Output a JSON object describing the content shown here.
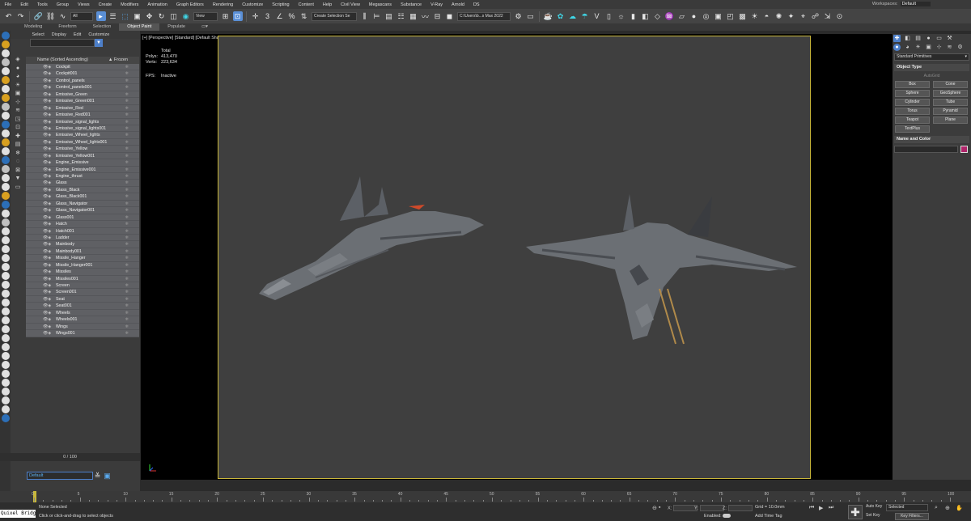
{
  "menu": [
    "File",
    "Edit",
    "Tools",
    "Group",
    "Views",
    "Create",
    "Modifiers",
    "Animation",
    "Graph Editors",
    "Rendering",
    "Customize",
    "Scripting",
    "Content",
    "Help",
    "Civil View",
    "Megascans",
    "Substance",
    "V-Ray",
    "Arnold",
    "DS"
  ],
  "workspaces": {
    "label": "Workspaces:",
    "value": "Default"
  },
  "toolbar": {
    "filter_value": "All",
    "view_value": "View",
    "selection_set_placeholder": "Create Selection Se",
    "path_value": "C:\\Users\\b...s Max 2022"
  },
  "ribbon_tabs": [
    "Modeling",
    "Freeform",
    "Selection",
    "Object Paint",
    "Populate"
  ],
  "ribbon_active": "Object Paint",
  "scene_explorer": {
    "tabs": [
      "Select",
      "Display",
      "Edit",
      "Customize"
    ],
    "header": "Name (Sorted Ascending)",
    "frozen_label": "▲ Frozen",
    "items": [
      "Cockpit",
      "Cockpit001",
      "Control_panels",
      "Control_panels001",
      "Emissive_Green",
      "Emissive_Green001",
      "Emissive_Red",
      "Emissive_Red001",
      "Emissive_signal_lights",
      "Emissive_signal_lights001",
      "Emissive_Wheel_lights",
      "Emissive_Wheel_lights001",
      "Emissive_Yellow",
      "Emissive_Yellow001",
      "Engine_Emissive",
      "Engine_Emissive001",
      "Engine_thrust",
      "Glass",
      "Glass_Black",
      "Glass_Black001",
      "Glass_Navigator",
      "Glass_Navigator001",
      "Glass001",
      "Hatch",
      "Hatch001",
      "Ladder",
      "Mainbody",
      "Mainbody001",
      "Missile_Hanger",
      "Missile_Hanger001",
      "Missiles",
      "Missiles001",
      "Screen",
      "Screen001",
      "Seat",
      "Seat001",
      "Wheels",
      "Wheels001",
      "Wings",
      "Wings001"
    ],
    "layer_value": "Default"
  },
  "frame_counter": "0 / 100",
  "viewport": {
    "label": "[+] [Perspective] [Standard] [Default Shading]",
    "stats_title": "Total",
    "polys_label": "Polys:",
    "polys_value": "413,470",
    "verts_label": "Verts:",
    "verts_value": "223,634",
    "fps_label": "FPS:",
    "fps_value": "Inactive"
  },
  "command_panel": {
    "dropdown": "Standard Primitives",
    "object_type_title": "Object Type",
    "autogrid": "AutoGrid",
    "buttons": [
      "Box",
      "Cone",
      "Sphere",
      "GeoSphere",
      "Cylinder",
      "Tube",
      "Torus",
      "Pyramid",
      "Teapot",
      "Plane",
      "TextPlus"
    ],
    "name_color_title": "Name and Color",
    "swatch_color": "#b0246a"
  },
  "timeline": {
    "ticks": [
      "0",
      "5",
      "10",
      "15",
      "20",
      "25",
      "30",
      "35",
      "40",
      "45",
      "50",
      "55",
      "60",
      "65",
      "70",
      "75",
      "80",
      "85",
      "90",
      "95",
      "100"
    ]
  },
  "status": {
    "maxscript": "Quixel Bridg",
    "line1": "None Selected",
    "line2": "Click or click-and-drag to select objects",
    "x_label": "X:",
    "y_label": "Y:",
    "z_label": "Z:",
    "grid": "Grid = 10.0mm",
    "enabled": "Enabled:",
    "add_time_tag": "Add Time Tag",
    "auto_key": "Auto Key",
    "set_key": "Set Key",
    "selected_value": "Selected",
    "key_filters": "Key Filters..."
  }
}
